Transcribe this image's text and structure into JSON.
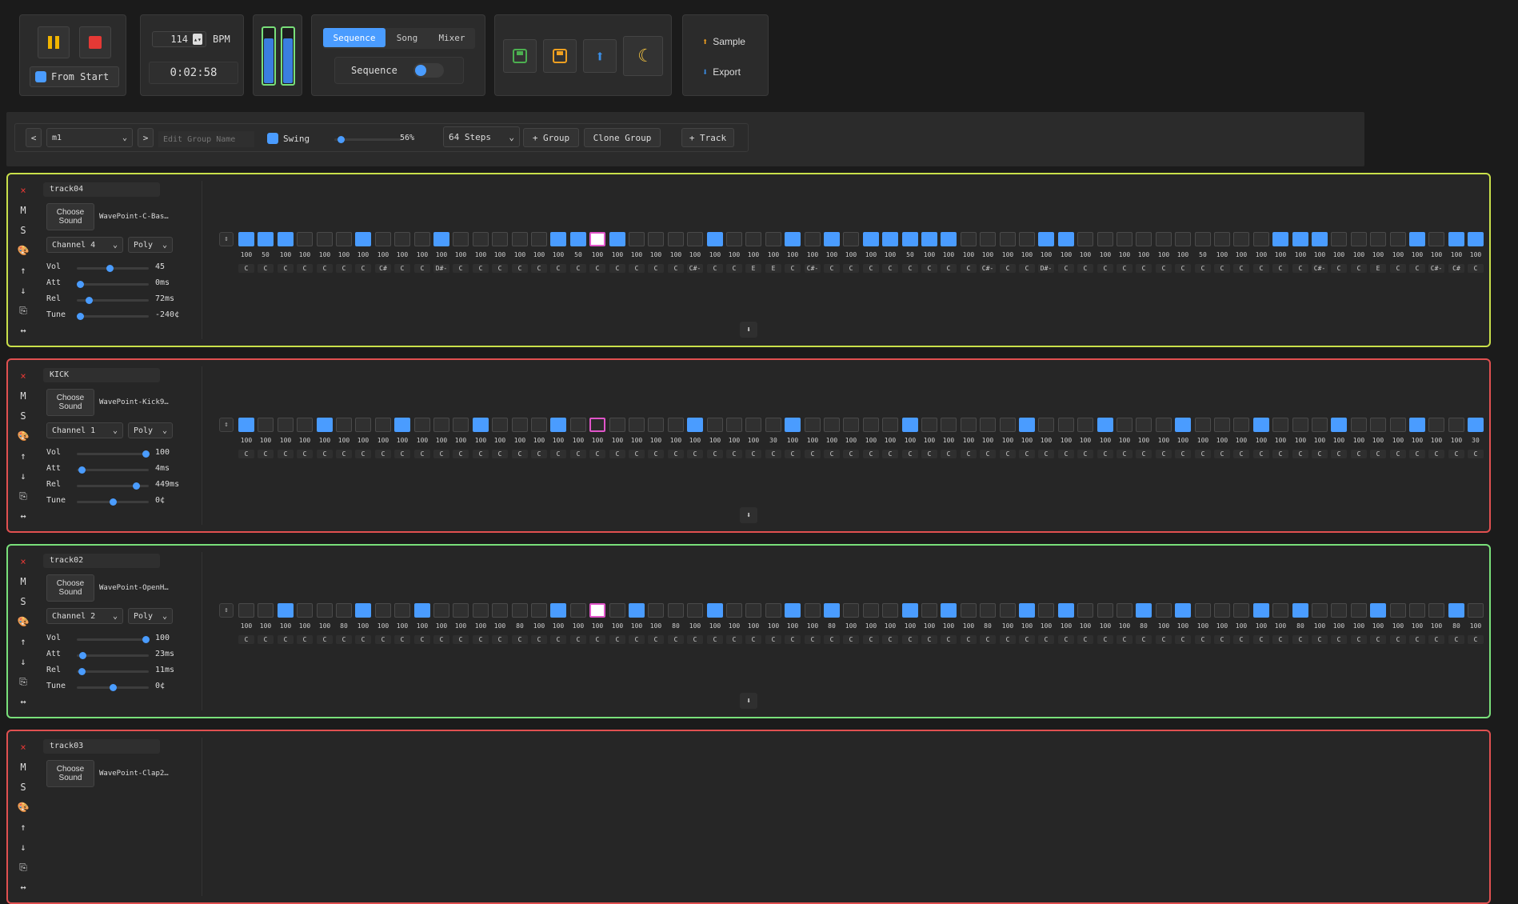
{
  "transport": {
    "pause_icon": "pause-icon",
    "stop_icon": "stop-icon",
    "from_start_label": "From Start",
    "from_start_checked": true,
    "bpm_value": "114",
    "bpm_unit": "BPM",
    "time": "0:02:58",
    "meter_levels": [
      0.8,
      0.8
    ]
  },
  "mode": {
    "tabs": [
      "Sequence",
      "Song",
      "Mixer"
    ],
    "active_tab": "Sequence",
    "toggle_label": "Sequence",
    "toggle_on": true
  },
  "file_actions": {
    "icons": [
      "save-green-icon",
      "save-orange-icon",
      "upload-icon",
      "moon-icon"
    ]
  },
  "sample_export": {
    "sample_label": "Sample",
    "export_label": "Export"
  },
  "group_bar": {
    "prev": "<",
    "group_value": "m1",
    "next": ">",
    "group_name_placeholder": "Edit Group Name",
    "swing_label": "Swing",
    "swing_checked": true,
    "swing_value": "56%",
    "swing_fraction": 0.05,
    "steps_value": "64 Steps",
    "add_group": "+ Group",
    "clone_group": "Clone Group",
    "add_track": "+ Track"
  },
  "common": {
    "choose_line1": "Choose",
    "choose_line2": "Sound",
    "vol_label": "Vol",
    "att_label": "Att",
    "rel_label": "Rel",
    "tune_label": "Tune",
    "poly_label": "Poly",
    "remove_glyph": "×",
    "mute_label": "M",
    "solo_label": "S"
  },
  "tracks": [
    {
      "name": "track04",
      "color": "#c9e04a",
      "sound": "WavePoint-C-Bas…",
      "channel": "Channel 4",
      "vol": "45",
      "vol_f": 0.45,
      "att": "0ms",
      "att_f": 0.0,
      "rel": "72ms",
      "rel_f": 0.14,
      "tune": "-240¢",
      "tune_f": 0.0,
      "steps": "1110001000100000111100001000101011111000011000000000011100001011",
      "vel": [
        "100",
        "50",
        "100",
        "100",
        "100",
        "100",
        "100",
        "100",
        "100",
        "100",
        "100",
        "100",
        "100",
        "100",
        "100",
        "100",
        "100",
        "50",
        "100",
        "100",
        "100",
        "100",
        "100",
        "100",
        "100",
        "100",
        "100",
        "100",
        "100",
        "100",
        "100",
        "100",
        "100",
        "100",
        "50",
        "100",
        "100",
        "100",
        "100",
        "100",
        "100",
        "100",
        "100",
        "100",
        "100",
        "100",
        "100",
        "100",
        "100",
        "50",
        "100",
        "100",
        "100",
        "100",
        "100",
        "100",
        "100",
        "100",
        "100",
        "100",
        "100",
        "100",
        "100",
        "100"
      ],
      "notes": [
        "C",
        "C",
        "C",
        "C",
        "C",
        "C",
        "C",
        "C#",
        "C",
        "C",
        "D#-",
        "C",
        "C",
        "C",
        "C",
        "C",
        "C",
        "C",
        "C",
        "C",
        "C",
        "C",
        "C",
        "C#-",
        "C",
        "C",
        "E",
        "E",
        "C",
        "C#-",
        "C",
        "C",
        "C",
        "C",
        "C",
        "C",
        "C",
        "C",
        "C#-",
        "C",
        "C",
        "D#-",
        "C",
        "C",
        "C",
        "C",
        "C",
        "C",
        "C",
        "C",
        "C",
        "C",
        "C",
        "C",
        "C",
        "C#-",
        "C",
        "C",
        "E",
        "C",
        "C",
        "C#-",
        "C#",
        "C"
      ],
      "cursor": "white"
    },
    {
      "name": "KICK",
      "color": "#e05050",
      "sound": "WavePoint-Kick9…",
      "channel": "Channel 1",
      "vol": "100",
      "vol_f": 1.0,
      "att": "4ms",
      "att_f": 0.02,
      "rel": "449ms",
      "rel_f": 0.85,
      "tune": "0¢",
      "tune_f": 0.5,
      "steps": "1000100010001000100000010000100000100000100010001000100010001001",
      "vel": [
        "100",
        "100",
        "100",
        "100",
        "100",
        "100",
        "100",
        "100",
        "100",
        "100",
        "100",
        "100",
        "100",
        "100",
        "100",
        "100",
        "100",
        "100",
        "100",
        "100",
        "100",
        "100",
        "100",
        "100",
        "100",
        "100",
        "100",
        "30",
        "100",
        "100",
        "100",
        "100",
        "100",
        "100",
        "100",
        "100",
        "100",
        "100",
        "100",
        "100",
        "100",
        "100",
        "100",
        "100",
        "100",
        "100",
        "100",
        "100",
        "100",
        "100",
        "100",
        "100",
        "100",
        "100",
        "100",
        "100",
        "100",
        "100",
        "100",
        "100",
        "100",
        "100",
        "100",
        "30"
      ],
      "notes": [
        "C",
        "C",
        "C",
        "C",
        "C",
        "C",
        "C",
        "C",
        "C",
        "C",
        "C",
        "C",
        "C",
        "C",
        "C",
        "C",
        "C",
        "C",
        "C",
        "C",
        "C",
        "C",
        "C",
        "C",
        "C",
        "C",
        "C",
        "C",
        "C",
        "C",
        "C",
        "C",
        "C",
        "C",
        "C",
        "C",
        "C",
        "C",
        "C",
        "C",
        "C",
        "C",
        "C",
        "C",
        "C",
        "C",
        "C",
        "C",
        "C",
        "C",
        "C",
        "C",
        "C",
        "C",
        "C",
        "C",
        "C",
        "C",
        "C",
        "C",
        "C",
        "C",
        "C",
        "C"
      ],
      "cursor": "empty"
    },
    {
      "name": "track02",
      "color": "#79e07a",
      "sound": "WavePoint-OpenH…",
      "channel": "Channel 2",
      "vol": "100",
      "vol_f": 1.0,
      "att": "23ms",
      "att_f": 0.04,
      "rel": "11ms",
      "rel_f": 0.03,
      "tune": "0¢",
      "tune_f": 0.5,
      "steps": "0010001001000000101010001000101000101000101000101000101000100010",
      "vel": [
        "100",
        "100",
        "100",
        "100",
        "100",
        "80",
        "100",
        "100",
        "100",
        "100",
        "100",
        "100",
        "100",
        "100",
        "80",
        "100",
        "100",
        "100",
        "100",
        "100",
        "100",
        "100",
        "80",
        "100",
        "100",
        "100",
        "100",
        "100",
        "100",
        "100",
        "80",
        "100",
        "100",
        "100",
        "100",
        "100",
        "100",
        "100",
        "80",
        "100",
        "100",
        "100",
        "100",
        "100",
        "100",
        "100",
        "80",
        "100",
        "100",
        "100",
        "100",
        "100",
        "100",
        "100",
        "80",
        "100",
        "100",
        "100",
        "100",
        "100",
        "100",
        "100",
        "80",
        "100"
      ],
      "notes": [
        "C",
        "C",
        "C",
        "C",
        "C",
        "C",
        "C",
        "C",
        "C",
        "C",
        "C",
        "C",
        "C",
        "C",
        "C",
        "C",
        "C",
        "C",
        "C",
        "C",
        "C",
        "C",
        "C",
        "C",
        "C",
        "C",
        "C",
        "C",
        "C",
        "C",
        "C",
        "C",
        "C",
        "C",
        "C",
        "C",
        "C",
        "C",
        "C",
        "C",
        "C",
        "C",
        "C",
        "C",
        "C",
        "C",
        "C",
        "C",
        "C",
        "C",
        "C",
        "C",
        "C",
        "C",
        "C",
        "C",
        "C",
        "C",
        "C",
        "C",
        "C",
        "C",
        "C",
        "C"
      ],
      "cursor": "white"
    },
    {
      "name": "track03",
      "color": "#e05050",
      "sound": "WavePoint-Clap2…",
      "partial": true
    }
  ]
}
